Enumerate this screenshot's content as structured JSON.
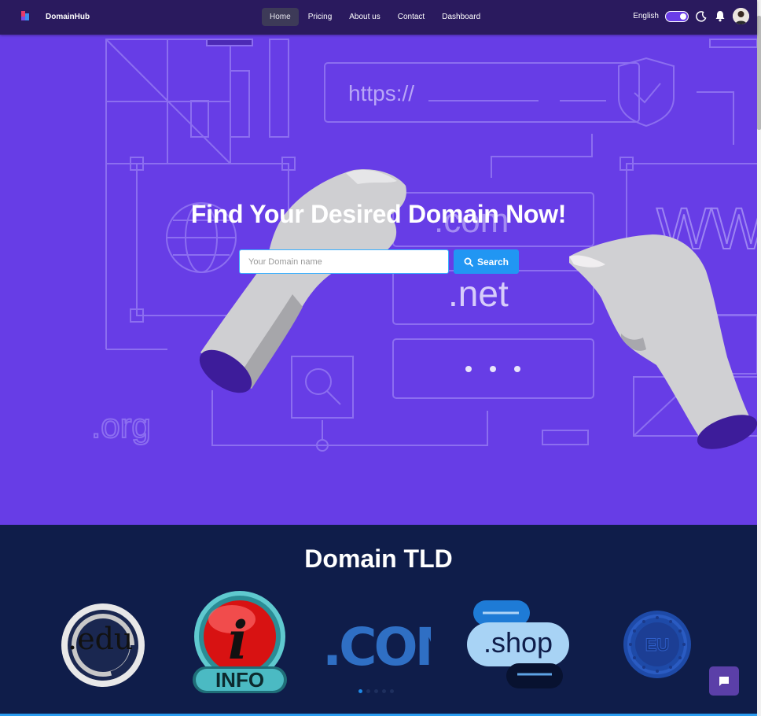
{
  "navbar": {
    "brand": "DomainHub",
    "links": [
      "Home",
      "Pricing",
      "About us",
      "Contact",
      "Dashboard"
    ],
    "active_link": "Home",
    "language": "English"
  },
  "hero": {
    "title": "Find Your Desired Domain Now!",
    "search_placeholder": "Your Domain name",
    "search_button": "Search",
    "bg_labels": {
      "url": "https://",
      "com": ".com",
      "net": ".net",
      "www": "WW",
      "org": ".org"
    }
  },
  "tld": {
    "title": "Domain TLD",
    "logos": [
      ".edu",
      "INFO",
      ".COM",
      ".shop",
      "EU"
    ],
    "carousel_dots": 5,
    "active_dot": 0
  },
  "colors": {
    "hero_bg": "#673de6",
    "navbar_bg": "#2a1a5e",
    "tld_bg": "#0f1d4a",
    "accent": "#2196f3"
  }
}
